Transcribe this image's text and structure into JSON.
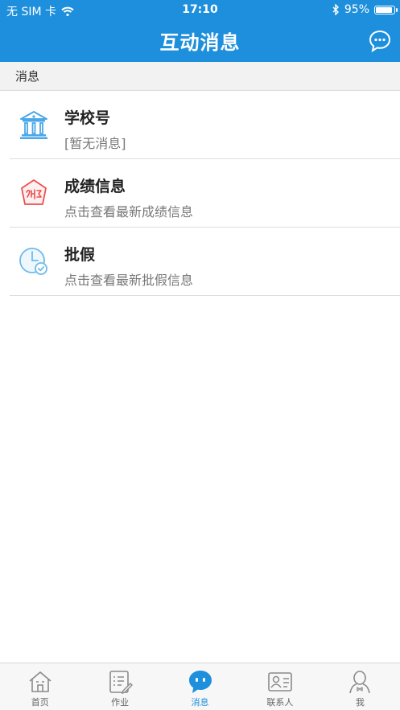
{
  "status_bar": {
    "carrier": "无 SIM 卡",
    "time": "17:10",
    "battery": "95%",
    "battery_level": 0.95
  },
  "header": {
    "title": "互动消息"
  },
  "section": {
    "label": "消息"
  },
  "messages": [
    {
      "title": "学校号",
      "subtitle": "[暂无消息]",
      "icon": "school-building-icon"
    },
    {
      "title": "成绩信息",
      "subtitle": "点击查看最新成绩信息",
      "icon": "score-tag-icon"
    },
    {
      "title": "批假",
      "subtitle": "点击查看最新批假信息",
      "icon": "clock-check-icon"
    }
  ],
  "tabs": [
    {
      "label": "首页",
      "icon": "home-icon",
      "active": false
    },
    {
      "label": "作业",
      "icon": "homework-icon",
      "active": false
    },
    {
      "label": "消息",
      "icon": "message-icon",
      "active": true
    },
    {
      "label": "联系人",
      "icon": "contact-card-icon",
      "active": false
    },
    {
      "label": "我",
      "icon": "profile-icon",
      "active": false
    }
  ],
  "colors": {
    "primary": "#1e8fdc",
    "school_icon": "#4aa8e8",
    "score_icon": "#e8504f",
    "leave_icon": "#6dbbea",
    "tab_inactive": "#8a8a8a"
  }
}
